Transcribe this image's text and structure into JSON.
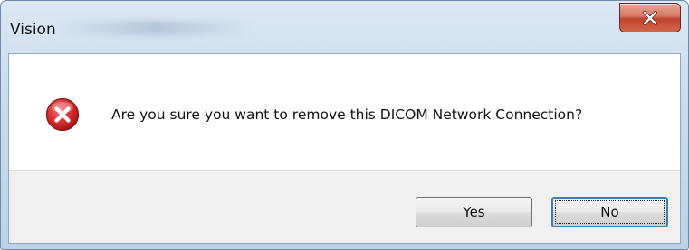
{
  "window": {
    "title": "Vision"
  },
  "dialog": {
    "message": "Are you sure you want to remove this DICOM Network Connection?",
    "icon": "error-icon"
  },
  "buttons": {
    "yes": {
      "mnemonic": "Y",
      "rest": "es"
    },
    "no": {
      "mnemonic": "N",
      "rest": "o"
    }
  },
  "colors": {
    "close_button": "#c0432b",
    "error_icon": "#c4202a",
    "button_face": "#e6e6e6",
    "focus_border": "#3c7fb1"
  }
}
